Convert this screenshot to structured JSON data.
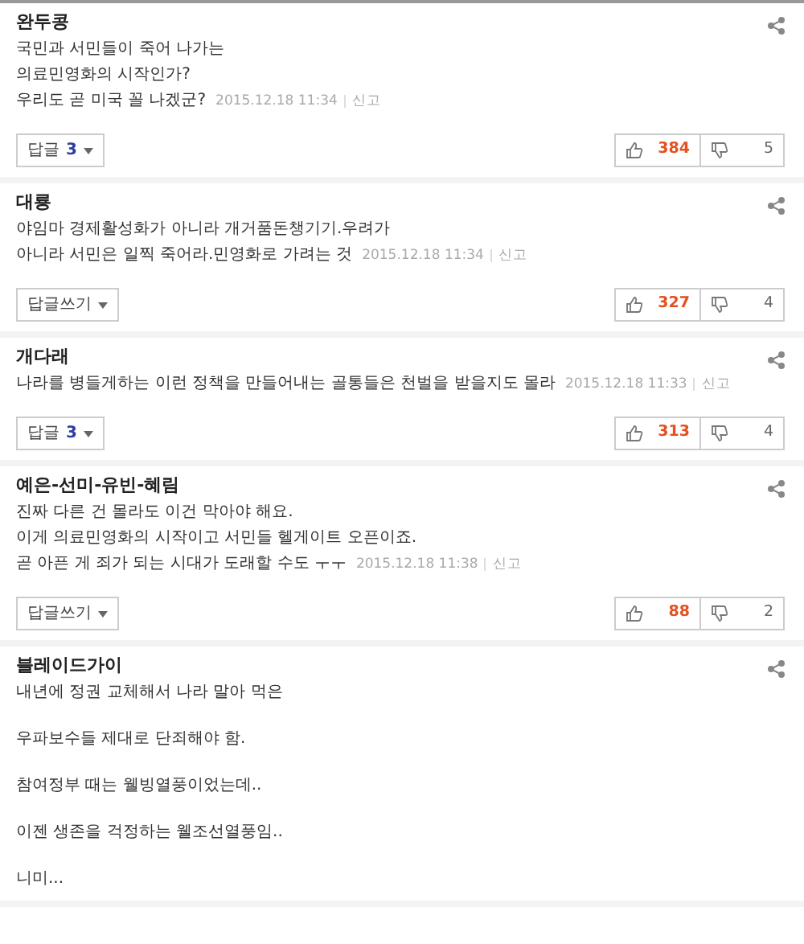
{
  "comments": [
    {
      "author": "완두콩",
      "paragraphs": [
        "국민과 서민들이 죽어 나가는\n의료민영화의 시작인가?\n우리도 곧 미국 꼴 나겠군?"
      ],
      "date": "2015.12.18 11:34",
      "report": "신고",
      "reply_label": "답글",
      "reply_count": "3",
      "likes": "384",
      "dislikes": "5"
    },
    {
      "author": "대룡",
      "paragraphs": [
        "야임마 경제활성화가 아니라 개거품돈챙기기.우려가\n아니라 서민은 일찍 죽어라.민영화로 가려는 것"
      ],
      "date": "2015.12.18 11:34",
      "report": "신고",
      "reply_label": "답글쓰기",
      "likes": "327",
      "dislikes": "4"
    },
    {
      "author": "개다래",
      "paragraphs": [
        "나라를 병들게하는 이런 정책을 만들어내는 골통들은 천벌을 받을지도 몰라"
      ],
      "date": "2015.12.18 11:33",
      "report": "신고",
      "reply_label": "답글",
      "reply_count": "3",
      "likes": "313",
      "dislikes": "4"
    },
    {
      "author": "예은-선미-유빈-혜림",
      "paragraphs": [
        "진짜 다른 건 몰라도 이건 막아야 해요.\n이게 의료민영화의 시작이고 서민들 헬게이트 오픈이죠.\n곧 아픈 게 죄가 되는 시대가 도래할 수도 ㅜㅜ"
      ],
      "date": "2015.12.18 11:38",
      "report": "신고",
      "reply_label": "답글쓰기",
      "likes": "88",
      "dislikes": "2"
    },
    {
      "author": "블레이드가이",
      "paragraphs": [
        "내년에 정권 교체해서 나라 말아 먹은",
        "우파보수들 제대로 단죄해야 함.",
        "참여정부 때는 웰빙열풍이었는데..",
        "이젠 생존을 걱정하는 웰조선열풍임..",
        "니미..."
      ]
    }
  ]
}
